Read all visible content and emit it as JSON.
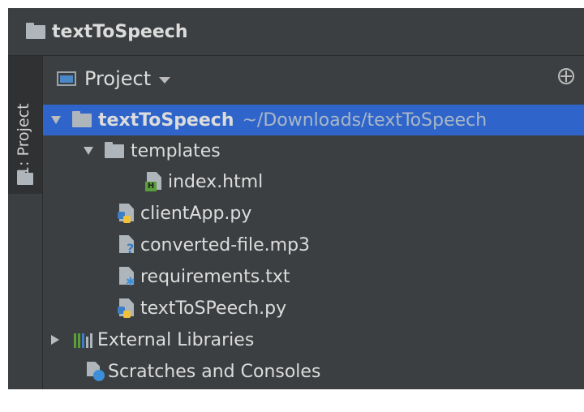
{
  "window": {
    "title": "textToSpeech"
  },
  "sidebar": {
    "tab_label": "1: Project"
  },
  "panel": {
    "title": "Project"
  },
  "tree": {
    "root": {
      "name": "textToSpeech",
      "path": "~/Downloads/textToSpeech"
    },
    "templates": {
      "name": "templates"
    },
    "index_html": {
      "name": "index.html"
    },
    "client_app": {
      "name": "clientApp.py"
    },
    "converted_file": {
      "name": "converted-file.mp3"
    },
    "requirements": {
      "name": "requirements.txt"
    },
    "tts_py": {
      "name": "textToSPeech.py"
    },
    "external_libraries": {
      "name": "External Libraries"
    },
    "scratches": {
      "name": "Scratches and Consoles"
    }
  },
  "colors": {
    "background": "#3c3f41",
    "selection": "#2f65ca",
    "text": "#dcdcdc",
    "python_blue": "#3d7fc4",
    "python_yellow": "#f0c23a",
    "html_green": "#5a9e3a"
  },
  "icons": {
    "folder": "folder-icon",
    "html": "html-file-icon",
    "python": "python-file-icon",
    "audio": "audio-file-icon",
    "text": "text-file-icon",
    "libraries": "libraries-icon",
    "scratches": "scratches-icon"
  }
}
